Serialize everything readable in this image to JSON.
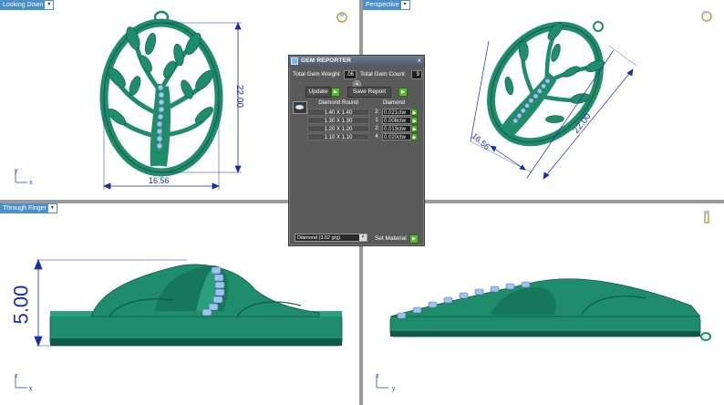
{
  "viewports": {
    "top_left": {
      "tab": "Looking Down",
      "dim_width": "16.56",
      "dim_height": "22.00",
      "axis_x": "x",
      "axis_y": "y"
    },
    "top_right": {
      "tab": "Perspective",
      "dim_width": "16.56",
      "dim_height": "22.00"
    },
    "bottom_left": {
      "tab": "Through Finger",
      "dim_height": "5.00",
      "axis_x": "x",
      "axis_z": "z"
    },
    "bottom_right": {
      "tab": "",
      "axis_y": "y",
      "axis_z": "z"
    }
  },
  "gem_reporter": {
    "title": "GEM REPORTER",
    "close": "×",
    "total_weight_label": "Total Gem Weight",
    "total_weight_value": ".06",
    "total_count_label": "Total Gem Count",
    "total_count_value": "9",
    "update_label": "Update",
    "save_report_label": "Save Report",
    "col_shape": "Diamond Round",
    "col_material": "Diamond",
    "rows": [
      {
        "size": "1.40 X 1.40",
        "count": "2",
        "weight": "0.021ctw"
      },
      {
        "size": "1.30 X 1.30",
        "count": "1",
        "weight": "0.008ctw"
      },
      {
        "size": "1.20 X 1.20",
        "count": "2",
        "weight": "0.013ctw"
      },
      {
        "size": "1.10 X 1.10",
        "count": "4",
        "weight": "0.020ctw"
      }
    ],
    "material_select": "Diamond    (3.52 g/g)",
    "set_material_label": "Set Material"
  },
  "colors": {
    "metal": "#1f8c6a",
    "metal_dark": "#0f5a42",
    "gem": "#9fc3ef",
    "dimension": "#1a2ea8"
  }
}
